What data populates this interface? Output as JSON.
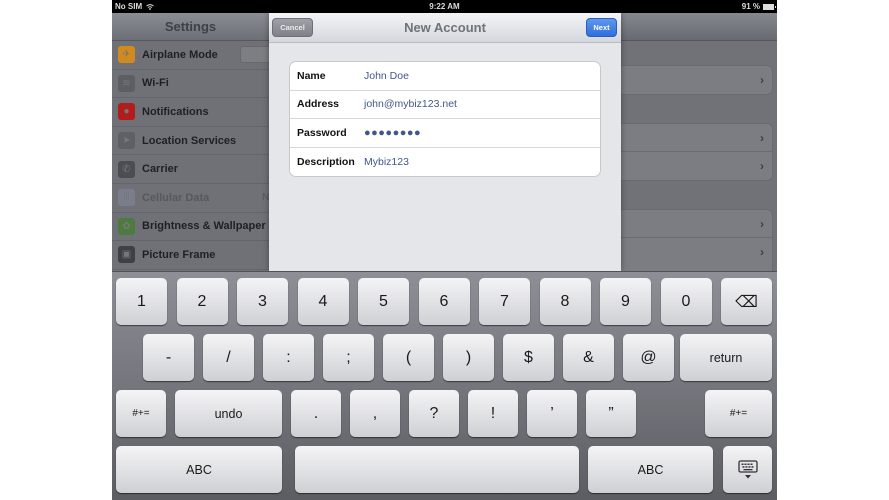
{
  "status_bar": {
    "carrier": "No SIM",
    "time": "9:22 AM",
    "battery": "91 %"
  },
  "settings": {
    "title": "Settings",
    "items": [
      {
        "label": "Airplane Mode",
        "icon": "airplane-icon",
        "color": "#d08a1e",
        "glyph": "✈"
      },
      {
        "label": "Wi-Fi",
        "icon": "wifi-icon",
        "color": "#5b5e63",
        "glyph": "≋"
      },
      {
        "label": "Notifications",
        "icon": "notifications-icon",
        "color": "#b11d1d",
        "glyph": "●"
      },
      {
        "label": "Location Services",
        "icon": "location-icon",
        "color": "#5d6066",
        "glyph": "➤"
      },
      {
        "label": "Carrier",
        "icon": "phone-icon",
        "color": "#4a4d52",
        "glyph": "✆"
      },
      {
        "label": "Cellular Data",
        "icon": "cellular-icon",
        "color": "#7a7e8c",
        "glyph": "Ⅲ",
        "extra": "N"
      },
      {
        "label": "Brightness & Wallpaper",
        "icon": "wallpaper-icon",
        "color": "#4d7a3e",
        "glyph": "✿"
      },
      {
        "label": "Picture Frame",
        "icon": "picture-frame-icon",
        "color": "#3e4045",
        "glyph": "▣"
      }
    ]
  },
  "modal": {
    "title": "New Account",
    "cancel_label": "Cancel",
    "next_label": "Next",
    "fields": [
      {
        "label": "Name",
        "value": "John Doe"
      },
      {
        "label": "Address",
        "value": "john@mybiz123.net"
      },
      {
        "label": "Password",
        "value": "●●●●●●●●"
      },
      {
        "label": "Description",
        "value": "Mybiz123"
      }
    ]
  },
  "keyboard": {
    "row1": [
      "1",
      "2",
      "3",
      "4",
      "5",
      "6",
      "7",
      "8",
      "9",
      "0"
    ],
    "backspace_icon": "⌫",
    "row2": [
      "-",
      "/",
      ":",
      ";",
      "(",
      ")",
      "$",
      "&",
      "@"
    ],
    "return_label": "return",
    "row3_left": "#+=",
    "undo_label": "undo",
    "row3": [
      ".",
      ",",
      "?",
      "!",
      "’",
      "”"
    ],
    "row3_right": "#+=",
    "abc_left": "ABC",
    "abc_right": "ABC",
    "hide_keyboard_icon": "keyboard-dismiss"
  }
}
